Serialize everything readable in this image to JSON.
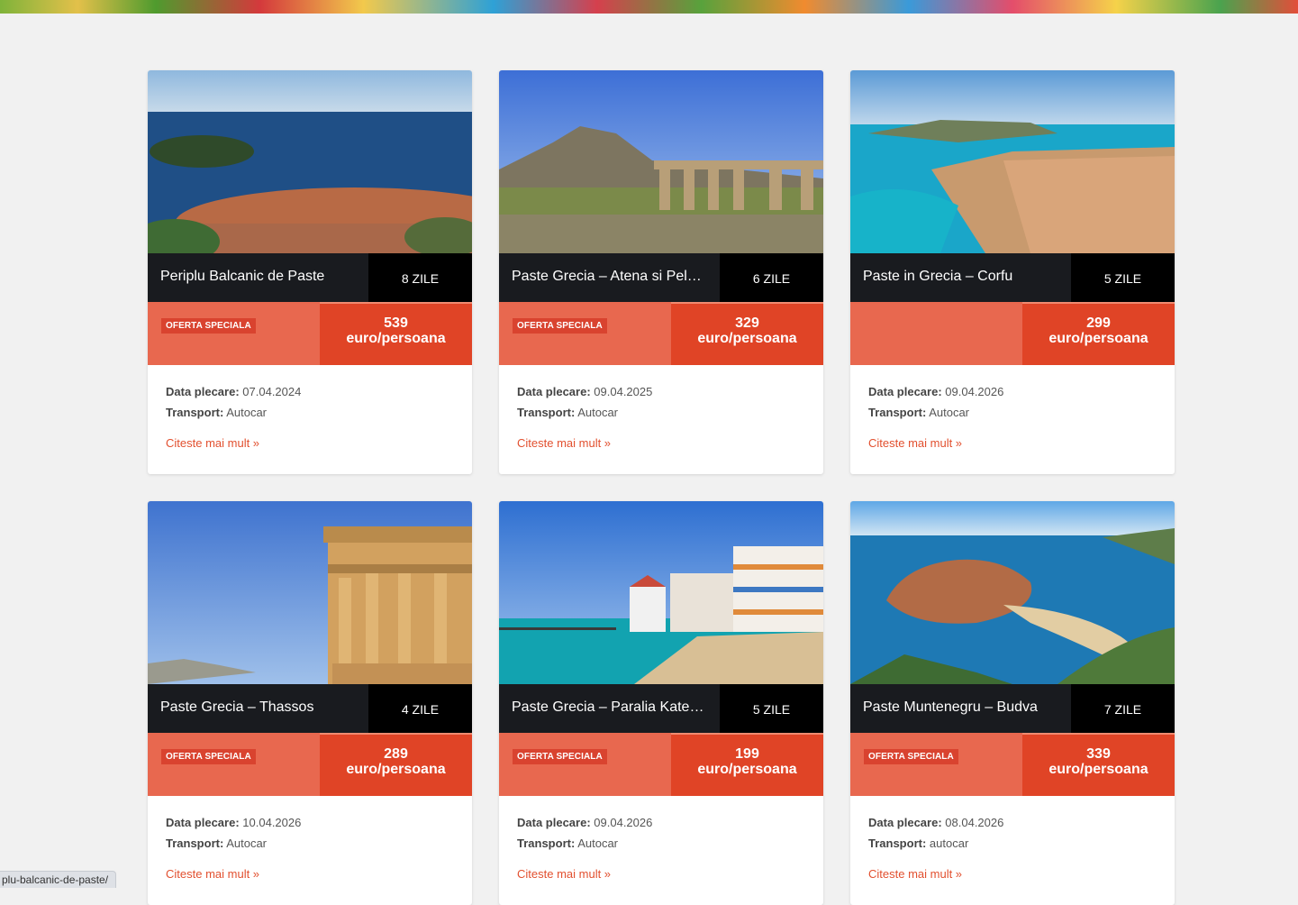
{
  "labels": {
    "badge": "OFERTA SPECIALA",
    "departure": "Data plecare:",
    "transport": "Transport:",
    "read_more": "Citeste mai mult »",
    "price_unit": "euro/persoana"
  },
  "status_url": "plu-balcanic-de-paste/",
  "colors": {
    "title_bar": "#191b1f",
    "days_bar": "#000000",
    "price_bar": "#e8684f",
    "price_box": "#e04426",
    "accent_link": "#e2502f"
  },
  "cards": [
    {
      "title": "Periplu Balcanic de Paste",
      "days": "8 ZILE",
      "special": true,
      "price": "539",
      "date": "07.04.2024",
      "transport": "Autocar",
      "image": "dubrovnik-coast-photo"
    },
    {
      "title": "Paste Grecia – Atena si Peloponez",
      "days": "6 ZILE",
      "special": true,
      "price": "329",
      "date": "09.04.2025",
      "transport": "Autocar",
      "image": "corinth-temple-photo"
    },
    {
      "title": "Paste in Grecia – Corfu",
      "days": "5 ZILE",
      "special": false,
      "price": "299",
      "date": "09.04.2026",
      "transport": "Autocar",
      "image": "corfu-town-photo"
    },
    {
      "title": "Paste Grecia – Thassos",
      "days": "4 ZILE",
      "special": true,
      "price": "289",
      "date": "10.04.2026",
      "transport": "Autocar",
      "image": "caryatids-photo"
    },
    {
      "title": "Paste Grecia – Paralia Katerini",
      "days": "5 ZILE",
      "special": true,
      "price": "199",
      "date": "09.04.2026",
      "transport": "Autocar",
      "image": "paralia-beach-photo"
    },
    {
      "title": "Paste Muntenegru – Budva",
      "days": "7 ZILE",
      "special": true,
      "price": "339",
      "date": "08.04.2026",
      "transport": "autocar",
      "image": "sveti-stefan-photo"
    }
  ]
}
